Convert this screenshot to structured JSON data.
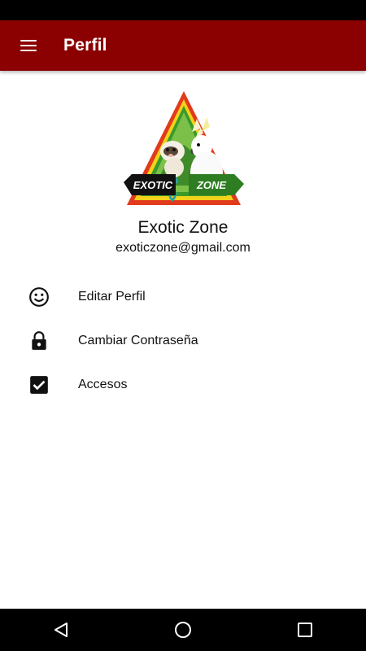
{
  "app_bar": {
    "title": "Perfil",
    "color": "#8b0000"
  },
  "logo": {
    "text_left": "EXOTIC",
    "text_right": "ZONE"
  },
  "profile": {
    "name": "Exotic Zone",
    "email": "exoticzone@gmail.com"
  },
  "menu": {
    "items": [
      {
        "label": "Editar Perfil",
        "icon": "smiley-face-icon"
      },
      {
        "label": "Cambiar Contraseña",
        "icon": "lock-icon"
      },
      {
        "label": "Accesos",
        "icon": "checkbox-checked-icon"
      }
    ]
  },
  "nav_bar": {
    "back_icon": "back-triangle-icon",
    "home_icon": "home-circle-icon",
    "recents_icon": "recents-square-icon"
  }
}
